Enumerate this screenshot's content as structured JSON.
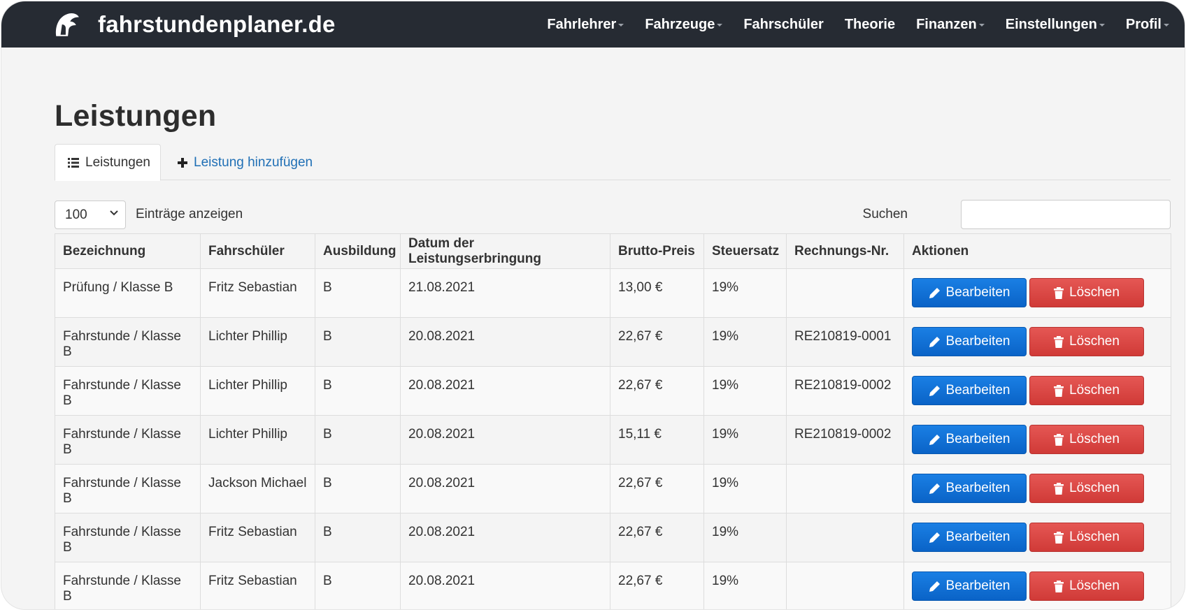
{
  "brand": {
    "name": "fahrstundenplaner.de",
    "logo_icon": "helmet-logo-icon"
  },
  "nav": {
    "items": [
      {
        "label": "Fahrlehrer",
        "dropdown": true
      },
      {
        "label": "Fahrzeuge",
        "dropdown": true
      },
      {
        "label": "Fahrschüler",
        "dropdown": false
      },
      {
        "label": "Theorie",
        "dropdown": false
      },
      {
        "label": "Finanzen",
        "dropdown": true
      },
      {
        "label": "Einstellungen",
        "dropdown": true
      },
      {
        "label": "Profil",
        "dropdown": true
      }
    ]
  },
  "page": {
    "title": "Leistungen"
  },
  "tabs": {
    "list_label": "Leistungen",
    "add_label": "Leistung hinzufügen"
  },
  "controls": {
    "length_value": "100",
    "length_label": "Einträge anzeigen",
    "search_label": "Suchen",
    "search_value": ""
  },
  "table": {
    "headers": {
      "bezeichnung": "Bezeichnung",
      "fahrschueler": "Fahrschüler",
      "ausbildung": "Ausbildung",
      "datum": "Datum der Leistungserbringung",
      "preis": "Brutto-Preis",
      "steuersatz": "Steuersatz",
      "rechnung": "Rechnungs-Nr.",
      "aktionen": "Aktionen"
    },
    "edit_label": "Bearbeiten",
    "delete_label": "Löschen",
    "rows": [
      {
        "bezeichnung": "Prüfung / Klasse B",
        "fahrschueler": "Fritz Sebastian",
        "ausbildung": "B",
        "datum": "21.08.2021",
        "preis": "13,00 €",
        "steuersatz": "19%",
        "rechnung": ""
      },
      {
        "bezeichnung": "Fahrstunde / Klasse B",
        "fahrschueler": "Lichter Phillip",
        "ausbildung": "B",
        "datum": "20.08.2021",
        "preis": "22,67 €",
        "steuersatz": "19%",
        "rechnung": "RE210819-0001"
      },
      {
        "bezeichnung": "Fahrstunde / Klasse B",
        "fahrschueler": "Lichter Phillip",
        "ausbildung": "B",
        "datum": "20.08.2021",
        "preis": "22,67 €",
        "steuersatz": "19%",
        "rechnung": "RE210819-0002"
      },
      {
        "bezeichnung": "Fahrstunde / Klasse B",
        "fahrschueler": "Lichter Phillip",
        "ausbildung": "B",
        "datum": "20.08.2021",
        "preis": "15,11 €",
        "steuersatz": "19%",
        "rechnung": "RE210819-0002"
      },
      {
        "bezeichnung": "Fahrstunde / Klasse B",
        "fahrschueler": "Jackson Michael",
        "ausbildung": "B",
        "datum": "20.08.2021",
        "preis": "22,67 €",
        "steuersatz": "19%",
        "rechnung": ""
      },
      {
        "bezeichnung": "Fahrstunde / Klasse B",
        "fahrschueler": "Fritz Sebastian",
        "ausbildung": "B",
        "datum": "20.08.2021",
        "preis": "22,67 €",
        "steuersatz": "19%",
        "rechnung": ""
      },
      {
        "bezeichnung": "Fahrstunde / Klasse B",
        "fahrschueler": "Fritz Sebastian",
        "ausbildung": "B",
        "datum": "20.08.2021",
        "preis": "22,67 €",
        "steuersatz": "19%",
        "rechnung": ""
      }
    ]
  },
  "colors": {
    "navbar": "#262b33",
    "edit_button": "#0a63c7",
    "delete_button": "#d03a37",
    "link": "#1f6fb5"
  }
}
